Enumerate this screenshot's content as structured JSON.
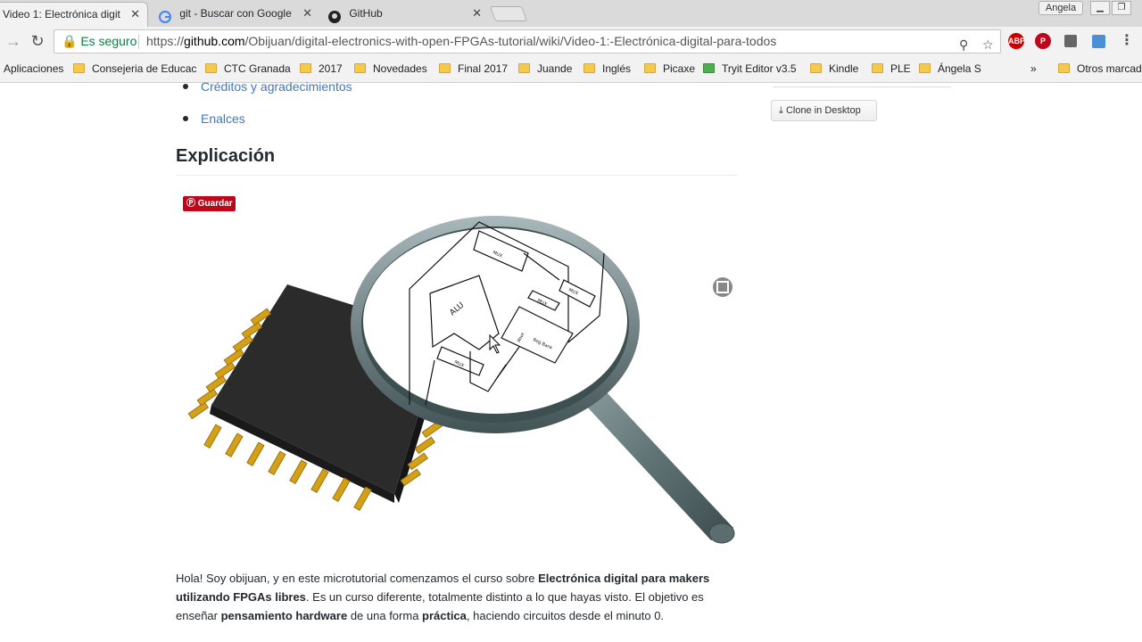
{
  "browser": {
    "tabs": [
      {
        "title": "Video 1: Electrónica digit",
        "active": true
      },
      {
        "title": "git - Buscar con Google",
        "active": false
      },
      {
        "title": "GitHub",
        "active": false
      }
    ],
    "profile_label": "Angela",
    "secure_label": "Es seguro",
    "url_scheme": "https://",
    "url_domain": "github.com",
    "url_path": "/Obijuan/digital-electronics-with-open-FPGAs-tutorial/wiki/Video-1:-Electrónica-digital-para-todos",
    "extensions": [
      "ABP",
      "P"
    ]
  },
  "bookmarks": [
    {
      "label": "Aplicaciones",
      "type": "apps"
    },
    {
      "label": "Consejeria de Educac",
      "type": "folder"
    },
    {
      "label": "CTC Granada",
      "type": "folder"
    },
    {
      "label": "2017",
      "type": "folder"
    },
    {
      "label": "Novedades",
      "type": "folder"
    },
    {
      "label": "Final 2017",
      "type": "folder"
    },
    {
      "label": "Juande",
      "type": "folder"
    },
    {
      "label": "Inglés",
      "type": "folder"
    },
    {
      "label": "Picaxe",
      "type": "folder"
    },
    {
      "label": "Tryit Editor v3.5",
      "type": "site"
    },
    {
      "label": "Kindle",
      "type": "folder"
    },
    {
      "label": "PLE",
      "type": "folder"
    },
    {
      "label": "Ángela S",
      "type": "folder"
    },
    {
      "label": "»",
      "type": "overflow"
    },
    {
      "label": "Otros marcad",
      "type": "folder"
    }
  ],
  "content": {
    "toc_items": [
      "Créditos y agradecimientos",
      "Enalces"
    ],
    "section_title": "Explicación",
    "pin_button": "Guardar",
    "diagram_labels": [
      "ALU",
      "Reg Bank",
      "MUX",
      "MUX",
      "MUX",
      "MUX",
      "dout"
    ],
    "paragraph": {
      "t1": "Hola! Soy obijuan, y en este microtutorial comenzamos el curso sobre ",
      "b1": "Electrónica digital para makers utilizando FPGAs libres",
      "t2": ". Es un curso diferente, totalmente distinto a lo que hayas visto. El objetivo es enseñar ",
      "b2": "pensamiento hardware",
      "t3": " de una forma ",
      "b3": "práctica",
      "t4": ", haciendo circuitos desde el minuto 0."
    }
  },
  "sidebar": {
    "clone_button": "Clone in Desktop"
  },
  "colors": {
    "link": "#4078c0",
    "secure": "#0b8043",
    "pinterest": "#bd081c",
    "chip_pins": "#d4a017"
  }
}
